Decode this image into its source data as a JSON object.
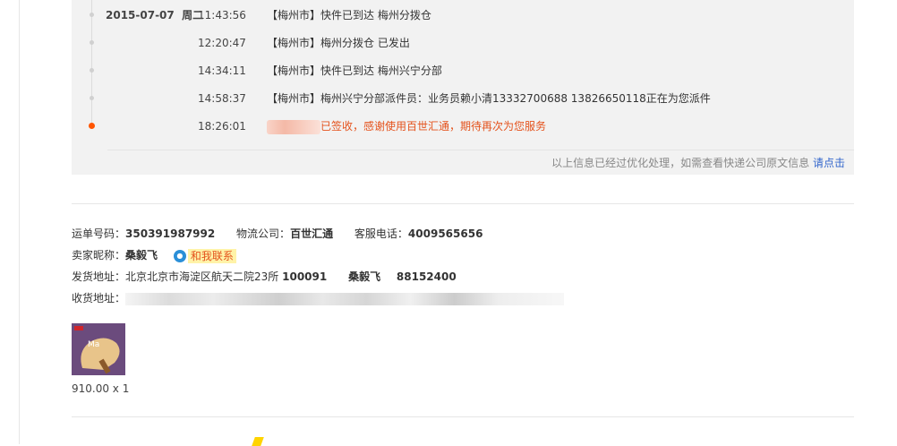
{
  "timeline": [
    {
      "date": "2015-07-07",
      "weekday": "周二",
      "time": "11:43:56",
      "msg": "【梅州市】快件已到达 梅州分拨仓",
      "current": false
    },
    {
      "date": "",
      "weekday": "",
      "time": "12:20:47",
      "msg": "【梅州市】梅州分拨仓 已发出",
      "current": false
    },
    {
      "date": "",
      "weekday": "",
      "time": "14:34:11",
      "msg": "【梅州市】快件已到达 梅州兴宁分部",
      "current": false
    },
    {
      "date": "",
      "weekday": "",
      "time": "14:58:37",
      "msg": "【梅州市】梅州兴宁分部派件员：业务员赖小清13332700688 13826650118正在为您派件",
      "current": false
    },
    {
      "date": "",
      "weekday": "",
      "time": "18:26:01",
      "msg": "已签收，感谢使用百世汇通，期待再次为您服务",
      "current": true
    }
  ],
  "note": {
    "text": "以上信息已经过优化处理，如需查看快递公司原文信息",
    "link": "请点击"
  },
  "order": {
    "waybill_label": "运单号码：",
    "waybill_value": "350391987992",
    "carrier_label": "物流公司：",
    "carrier_value": "百世汇通",
    "service_label": "客服电话：",
    "service_value": "4009565656",
    "seller_label": "卖家昵称：",
    "seller_value": "桑毅飞",
    "contact_label": "和我联系",
    "ship_label": "发货地址：",
    "ship_address": "北京北京市海淀区航天二院23所",
    "ship_zip": "100091",
    "ship_name": "桑毅飞",
    "ship_phone": "88152400",
    "recv_label": "收货地址："
  },
  "item": {
    "price": "910.00 x 1"
  },
  "colors": {
    "accent": "#e4521c",
    "link": "#3366cc",
    "current_dot": "#ff5500"
  }
}
